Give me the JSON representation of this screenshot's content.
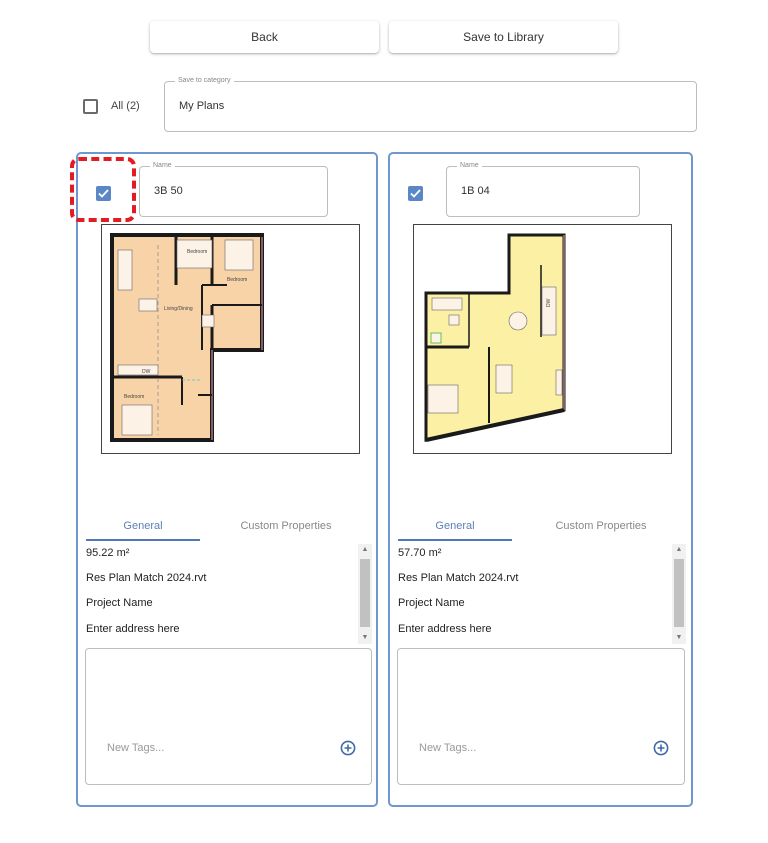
{
  "toolbar": {
    "back_label": "Back",
    "save_label": "Save to Library"
  },
  "select_all": {
    "label": "All (2)",
    "checked": false
  },
  "category": {
    "legend": "Save to category",
    "value": "My Plans"
  },
  "colors": {
    "accent": "#4f78b5",
    "card_border": "#6e97cf",
    "checkbox": "#5b87c7",
    "highlight": "#e31b23",
    "plan1_fill": "#f9d3a8",
    "plan2_fill": "#fbf0a4"
  },
  "cards": [
    {
      "checked": true,
      "highlighted": true,
      "name_legend": "Name",
      "name": "3B 50",
      "plan_image": "floor-plan-3-bedroom",
      "plan_labels": [
        "Bedroom",
        "Bedroom",
        "Living/Dining",
        "Bedroom",
        "DW"
      ],
      "tabs": [
        {
          "label": "General",
          "active": true
        },
        {
          "label": "Custom Properties",
          "active": false
        }
      ],
      "properties": [
        "95.22 m²",
        "Res Plan Match 2024.rvt",
        "Project Name",
        "Enter address here"
      ],
      "tags_placeholder": "New Tags..."
    },
    {
      "checked": true,
      "highlighted": false,
      "name_legend": "Name",
      "name": "1B 04",
      "plan_image": "floor-plan-1-bedroom",
      "plan_labels": [
        "DW"
      ],
      "tabs": [
        {
          "label": "General",
          "active": true
        },
        {
          "label": "Custom Properties",
          "active": false
        }
      ],
      "properties": [
        "57.70 m²",
        "Res Plan Match 2024.rvt",
        "Project Name",
        "Enter address here"
      ],
      "tags_placeholder": "New Tags..."
    }
  ]
}
